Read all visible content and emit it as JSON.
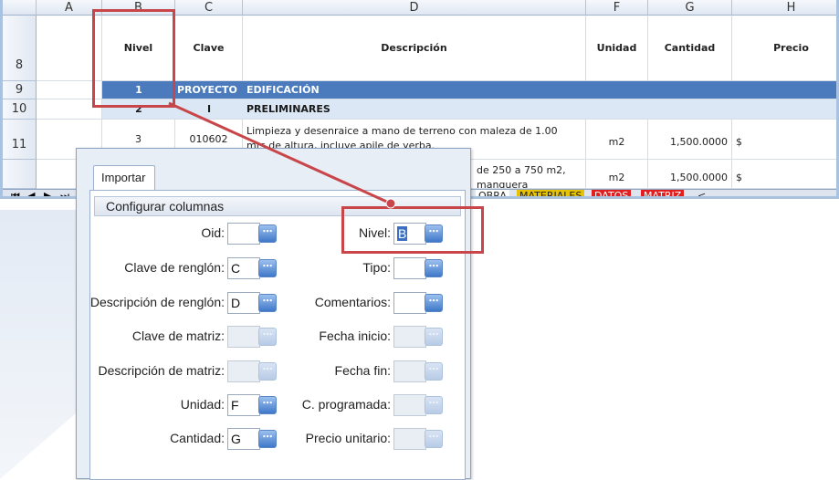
{
  "colors": {
    "accent": "#4b7bbd",
    "highlight_red": "#c8464a",
    "tab_materiales": "#e6c200",
    "tab_datos": "#e02020"
  },
  "sheet": {
    "column_headers": [
      "A",
      "B",
      "C",
      "D",
      "F",
      "G",
      "H"
    ],
    "row_numbers": [
      "8",
      "9",
      "10",
      "11",
      ""
    ],
    "header_row": {
      "nivel": "Nivel",
      "clave": "Clave",
      "descripcion": "Descripción",
      "unidad": "Unidad",
      "cantidad": "Cantidad",
      "precio": "Precio"
    },
    "rows": [
      {
        "nivel": "1",
        "clave": "PROYECTO",
        "descripcion": "EDIFICACIÓN",
        "unidad": "",
        "cantidad": "",
        "moneda": "",
        "precio": ""
      },
      {
        "nivel": "2",
        "clave": "I",
        "descripcion": "PRELIMINARES",
        "unidad": "",
        "cantidad": "",
        "moneda": "",
        "precio": ""
      },
      {
        "nivel": "3",
        "clave": "010602",
        "descripcion_line1": "Limpieza y desenraice a mano de terreno con maleza de 1.00",
        "descripcion_line2": "mts de altura, incluye apile de yerba.",
        "unidad": "m2",
        "cantidad": "1,500.0000",
        "moneda": "$",
        "precio": "-"
      },
      {
        "descripcion_line1": "de 250 a 750 m2,",
        "descripcion_line2": "manguera",
        "unidad": "m2",
        "cantidad": "1,500.0000",
        "moneda": "$",
        "precio": "-"
      }
    ],
    "sheet_tabs": [
      "OBRA",
      "MATERIALES",
      "DATOS",
      "MATRIZ"
    ],
    "nav_arrows": [
      "⏮",
      "◀",
      "▶",
      "⏭"
    ],
    "tab_scroll": "<"
  },
  "dialog": {
    "tab_label": "Importar",
    "group_title": "Configurar columnas",
    "left_fields": [
      {
        "label": "Oid:",
        "value": "",
        "enabled": true
      },
      {
        "label": "Clave de renglón:",
        "value": "C",
        "enabled": true
      },
      {
        "label": "Descripción de renglón:",
        "value": "D",
        "enabled": true
      },
      {
        "label": "Clave de matriz:",
        "value": "",
        "enabled": false
      },
      {
        "label": "Descripción de matriz:",
        "value": "",
        "enabled": false
      },
      {
        "label": "Unidad:",
        "value": "F",
        "enabled": true
      },
      {
        "label": "Cantidad:",
        "value": "G",
        "enabled": true
      }
    ],
    "right_fields": [
      {
        "label": "Nivel:",
        "value": "B",
        "enabled": true
      },
      {
        "label": "Tipo:",
        "value": "",
        "enabled": true
      },
      {
        "label": "Comentarios:",
        "value": "",
        "enabled": true
      },
      {
        "label": "Fecha inicio:",
        "value": "",
        "enabled": false
      },
      {
        "label": "Fecha fin:",
        "value": "",
        "enabled": false
      },
      {
        "label": "C. programada:",
        "value": "",
        "enabled": false
      },
      {
        "label": "Precio unitario:",
        "value": "",
        "enabled": false
      }
    ],
    "picker_icon": "ellipsis-icon",
    "picker_glyph": "⋯"
  }
}
